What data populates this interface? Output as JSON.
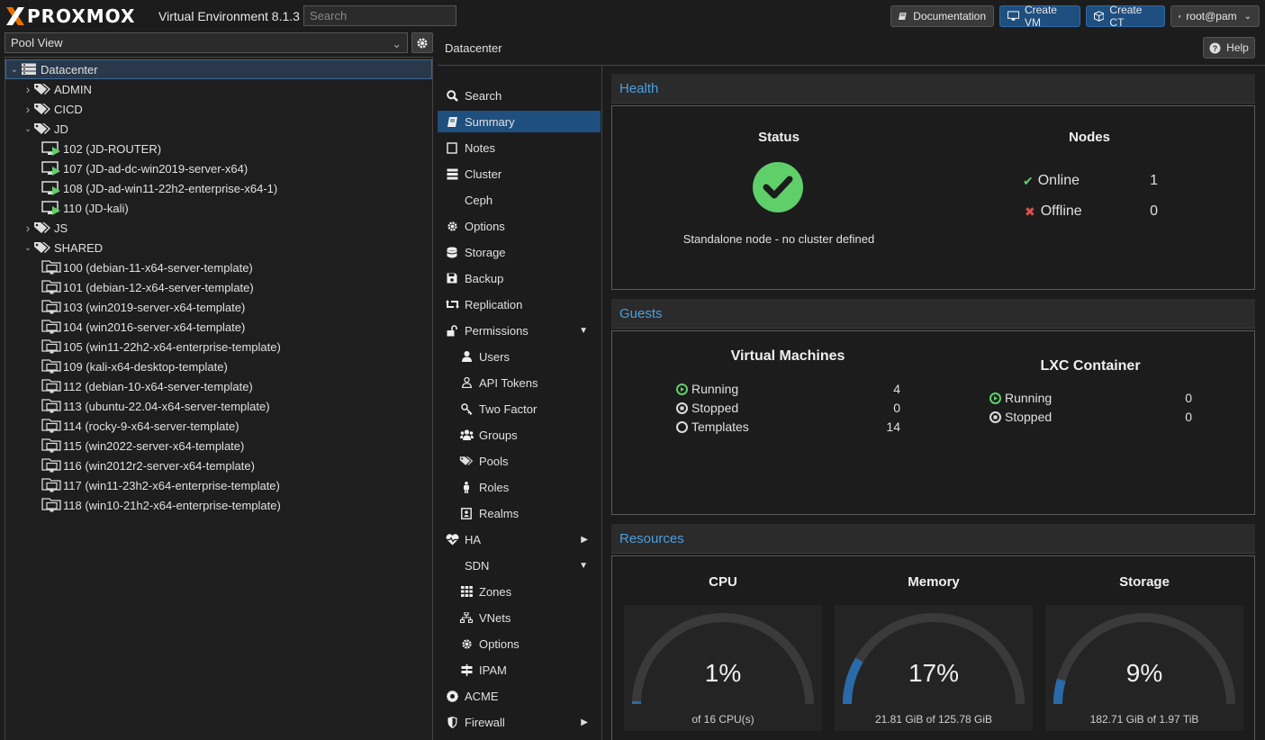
{
  "header": {
    "logo_text": "PROXMOX",
    "version": "Virtual Environment 8.1.3",
    "search_placeholder": "Search",
    "documentation": "Documentation",
    "create_vm": "Create VM",
    "create_ct": "Create CT",
    "user": "root@pam"
  },
  "left": {
    "view_selector": "Pool View",
    "tree": [
      {
        "label": "Datacenter",
        "level": 0,
        "icon": "datacenter-icon",
        "expanded": true,
        "selected": true
      },
      {
        "label": "ADMIN",
        "level": 1,
        "icon": "tags-icon",
        "expanded": false
      },
      {
        "label": "CICD",
        "level": 1,
        "icon": "tags-icon",
        "expanded": false
      },
      {
        "label": "JD",
        "level": 1,
        "icon": "tags-icon",
        "expanded": true
      },
      {
        "label": "102 (JD-ROUTER)",
        "level": 2,
        "icon": "vm-running-icon"
      },
      {
        "label": "107 (JD-ad-dc-win2019-server-x64)",
        "level": 2,
        "icon": "vm-running-icon"
      },
      {
        "label": "108 (JD-ad-win11-22h2-enterprise-x64-1)",
        "level": 2,
        "icon": "vm-running-icon"
      },
      {
        "label": "110 (JD-kali)",
        "level": 2,
        "icon": "vm-running-icon"
      },
      {
        "label": "JS",
        "level": 1,
        "icon": "tags-icon",
        "expanded": false
      },
      {
        "label": "SHARED",
        "level": 1,
        "icon": "tags-icon",
        "expanded": true
      },
      {
        "label": "100 (debian-11-x64-server-template)",
        "level": 2,
        "icon": "template-icon"
      },
      {
        "label": "101 (debian-12-x64-server-template)",
        "level": 2,
        "icon": "template-icon"
      },
      {
        "label": "103 (win2019-server-x64-template)",
        "level": 2,
        "icon": "template-icon"
      },
      {
        "label": "104 (win2016-server-x64-template)",
        "level": 2,
        "icon": "template-icon"
      },
      {
        "label": "105 (win11-22h2-x64-enterprise-template)",
        "level": 2,
        "icon": "template-icon"
      },
      {
        "label": "109 (kali-x64-desktop-template)",
        "level": 2,
        "icon": "template-icon"
      },
      {
        "label": "112 (debian-10-x64-server-template)",
        "level": 2,
        "icon": "template-icon"
      },
      {
        "label": "113 (ubuntu-22.04-x64-server-template)",
        "level": 2,
        "icon": "template-icon"
      },
      {
        "label": "114 (rocky-9-x64-server-template)",
        "level": 2,
        "icon": "template-icon"
      },
      {
        "label": "115 (win2022-server-x64-template)",
        "level": 2,
        "icon": "template-icon"
      },
      {
        "label": "116 (win2012r2-server-x64-template)",
        "level": 2,
        "icon": "template-icon"
      },
      {
        "label": "117 (win11-23h2-x64-enterprise-template)",
        "level": 2,
        "icon": "template-icon"
      },
      {
        "label": "118 (win10-21h2-x64-enterprise-template)",
        "level": 2,
        "icon": "template-icon"
      }
    ]
  },
  "content": {
    "breadcrumb": "Datacenter",
    "help": "Help",
    "menu": [
      {
        "label": "Search",
        "icon": "search-icon",
        "sub": false
      },
      {
        "label": "Summary",
        "icon": "book-icon",
        "sub": false,
        "selected": true
      },
      {
        "label": "Notes",
        "icon": "notes-icon",
        "sub": false
      },
      {
        "label": "Cluster",
        "icon": "server-icon",
        "sub": false
      },
      {
        "label": "Ceph",
        "icon": "ceph-icon",
        "sub": false
      },
      {
        "label": "Options",
        "icon": "gear-icon",
        "sub": false
      },
      {
        "label": "Storage",
        "icon": "database-icon",
        "sub": false
      },
      {
        "label": "Backup",
        "icon": "floppy-icon",
        "sub": false
      },
      {
        "label": "Replication",
        "icon": "retweet-icon",
        "sub": false
      },
      {
        "label": "Permissions",
        "icon": "unlock-icon",
        "sub": false,
        "arrow": "down"
      },
      {
        "label": "Users",
        "icon": "user-icon",
        "sub": true
      },
      {
        "label": "API Tokens",
        "icon": "user-outline-icon",
        "sub": true
      },
      {
        "label": "Two Factor",
        "icon": "key-icon",
        "sub": true
      },
      {
        "label": "Groups",
        "icon": "users-icon",
        "sub": true
      },
      {
        "label": "Pools",
        "icon": "tags-icon",
        "sub": true
      },
      {
        "label": "Roles",
        "icon": "male-icon",
        "sub": true
      },
      {
        "label": "Realms",
        "icon": "id-badge-icon",
        "sub": true
      },
      {
        "label": "HA",
        "icon": "heartbeat-icon",
        "sub": false,
        "arrow": "right"
      },
      {
        "label": "SDN",
        "icon": "sdn-icon",
        "sub": false,
        "arrow": "down"
      },
      {
        "label": "Zones",
        "icon": "grid-icon",
        "sub": true
      },
      {
        "label": "VNets",
        "icon": "sitemap-icon",
        "sub": true
      },
      {
        "label": "Options",
        "icon": "gear-icon",
        "sub": true
      },
      {
        "label": "IPAM",
        "icon": "signs-icon",
        "sub": true
      },
      {
        "label": "ACME",
        "icon": "certificate-icon",
        "sub": false
      },
      {
        "label": "Firewall",
        "icon": "shield-icon",
        "sub": false,
        "arrow": "right"
      }
    ],
    "health": {
      "title": "Health",
      "status_label": "Status",
      "status_text": "Standalone node - no cluster defined",
      "nodes_label": "Nodes",
      "online_label": "Online",
      "online_count": "1",
      "offline_label": "Offline",
      "offline_count": "0"
    },
    "guests": {
      "title": "Guests",
      "vm_label": "Virtual Machines",
      "vm_running_label": "Running",
      "vm_running": "4",
      "vm_stopped_label": "Stopped",
      "vm_stopped": "0",
      "vm_templates_label": "Templates",
      "vm_templates": "14",
      "lxc_label": "LXC Container",
      "lxc_running_label": "Running",
      "lxc_running": "0",
      "lxc_stopped_label": "Stopped",
      "lxc_stopped": "0"
    },
    "resources": {
      "title": "Resources",
      "cpu_label": "CPU",
      "cpu_pct": "1%",
      "cpu_value": 0.01,
      "cpu_sub": "of 16 CPU(s)",
      "mem_label": "Memory",
      "mem_pct": "17%",
      "mem_value": 0.17,
      "mem_sub": "21.81 GiB of 125.78 GiB",
      "storage_label": "Storage",
      "storage_pct": "9%",
      "storage_value": 0.09,
      "storage_sub": "182.71 GiB of 1.97 TiB"
    }
  },
  "colors": {
    "accent": "#1e4f7f",
    "header_text": "#4b9fe0",
    "running": "#5fcf6a",
    "error": "#e05050",
    "gauge_fill": "#2a6aa8",
    "gauge_track": "#3a3a3a"
  }
}
